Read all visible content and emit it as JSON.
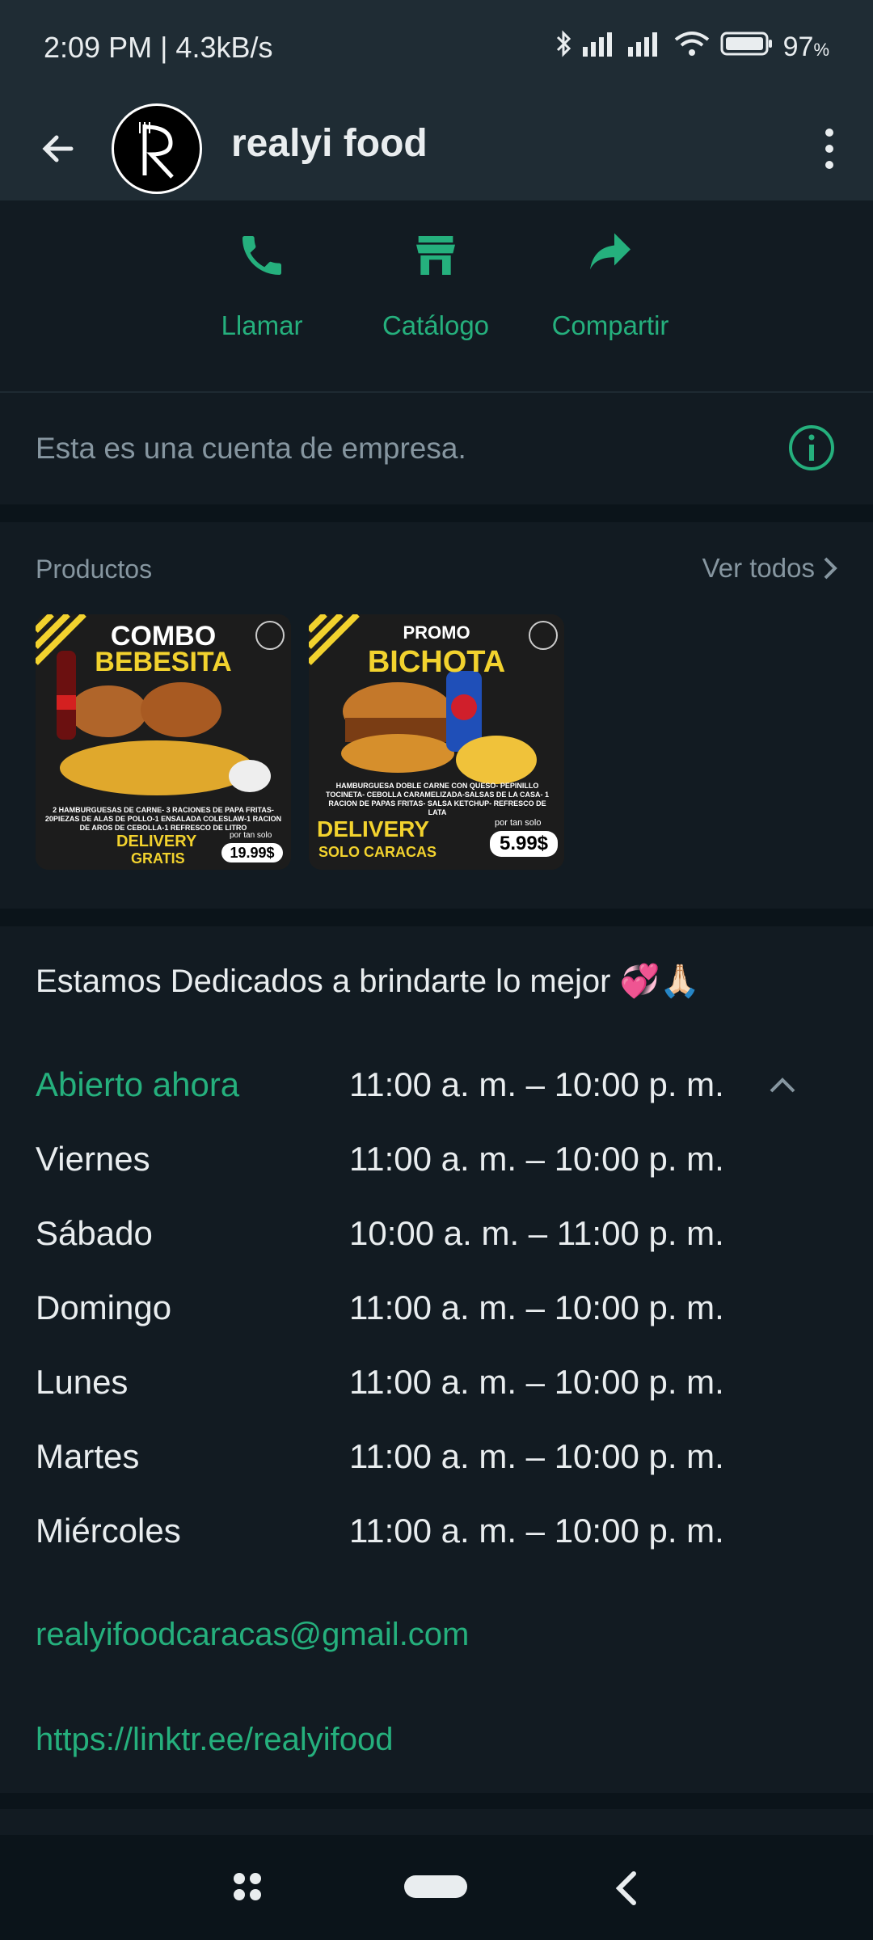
{
  "status_bar": {
    "time": "2:09 PM | 4.3kB/s",
    "battery": "97",
    "battery_unit": "%"
  },
  "header": {
    "title": "realyi food"
  },
  "actions": [
    {
      "label": "Llamar",
      "icon": "phone-icon"
    },
    {
      "label": "Catálogo",
      "icon": "store-icon"
    },
    {
      "label": "Compartir",
      "icon": "share-icon"
    }
  ],
  "business_notice": "Esta es una cuenta de empresa.",
  "products": {
    "title": "Productos",
    "see_all": "Ver todos",
    "items": [
      {
        "line1": "COMBO",
        "line2": "BEBESITA",
        "desc": "2 HAMBURGUESAS DE CARNE- 3 RACIONES DE PAPA FRITAS- 20PIEZAS DE ALAS DE POLLO-1 ENSALADA COLESLAW-1 RACION DE AROS DE CEBOLLA-1 REFRESCO DE LITRO",
        "delivery": "DELIVERY",
        "delivery_sub": "GRATIS",
        "price_label": "por tan solo",
        "price": "19.99$"
      },
      {
        "line1": "PROMO",
        "line2": "BICHOTA",
        "desc": "HAMBURGUESA DOBLE CARNE CON QUESO- PEPINILLO TOCINETA- CEBOLLA CARAMELIZADA-SALSAS DE LA CASA- 1 RACION DE PAPAS FRITAS- SALSA KETCHUP- REFRESCO DE LATA",
        "delivery": "DELIVERY",
        "delivery_sub": "SOLO CARACAS",
        "price_label": "por tan solo",
        "price": "5.99$"
      }
    ]
  },
  "about": "Estamos Dedicados a brindarte lo mejor 💞🙏🏻",
  "hours": [
    {
      "day": "Abierto ahora",
      "time": "11:00 a. m. – 10:00 p. m."
    },
    {
      "day": "Viernes",
      "time": "11:00 a. m. – 10:00 p. m."
    },
    {
      "day": "Sábado",
      "time": "10:00 a. m. – 11:00 p. m."
    },
    {
      "day": "Domingo",
      "time": "11:00 a. m. – 10:00 p. m."
    },
    {
      "day": "Lunes",
      "time": "11:00 a. m. – 10:00 p. m."
    },
    {
      "day": "Martes",
      "time": "11:00 a. m. – 10:00 p. m."
    },
    {
      "day": "Miércoles",
      "time": "11:00 a. m. – 10:00 p. m."
    }
  ],
  "email": "realyifoodcaracas@gmail.com",
  "website": "https://linktr.ee/realyifood",
  "colors": {
    "accent": "#25b07d",
    "header_bg": "#1f2c34",
    "bg": "#121b22"
  }
}
